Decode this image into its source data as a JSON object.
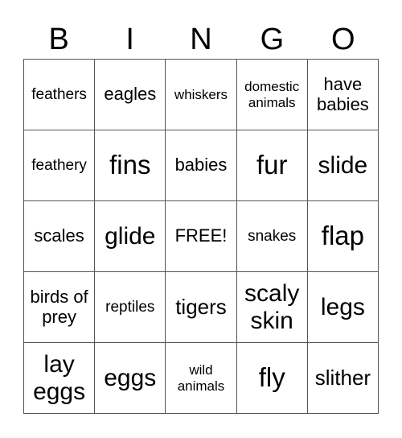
{
  "header": {
    "letters": [
      "B",
      "I",
      "N",
      "G",
      "O"
    ]
  },
  "grid": {
    "cells": [
      [
        "feathers",
        "eagles",
        "whiskers",
        "domestic animals",
        "have babies"
      ],
      [
        "feathery",
        "fins",
        "babies",
        "fur",
        "slide"
      ],
      [
        "scales",
        "glide",
        "FREE!",
        "snakes",
        "flap"
      ],
      [
        "birds of prey",
        "reptiles",
        "tigers",
        "scaly skin",
        "legs"
      ],
      [
        "lay eggs",
        "eggs",
        "wild animals",
        "fly",
        "slither"
      ]
    ]
  }
}
